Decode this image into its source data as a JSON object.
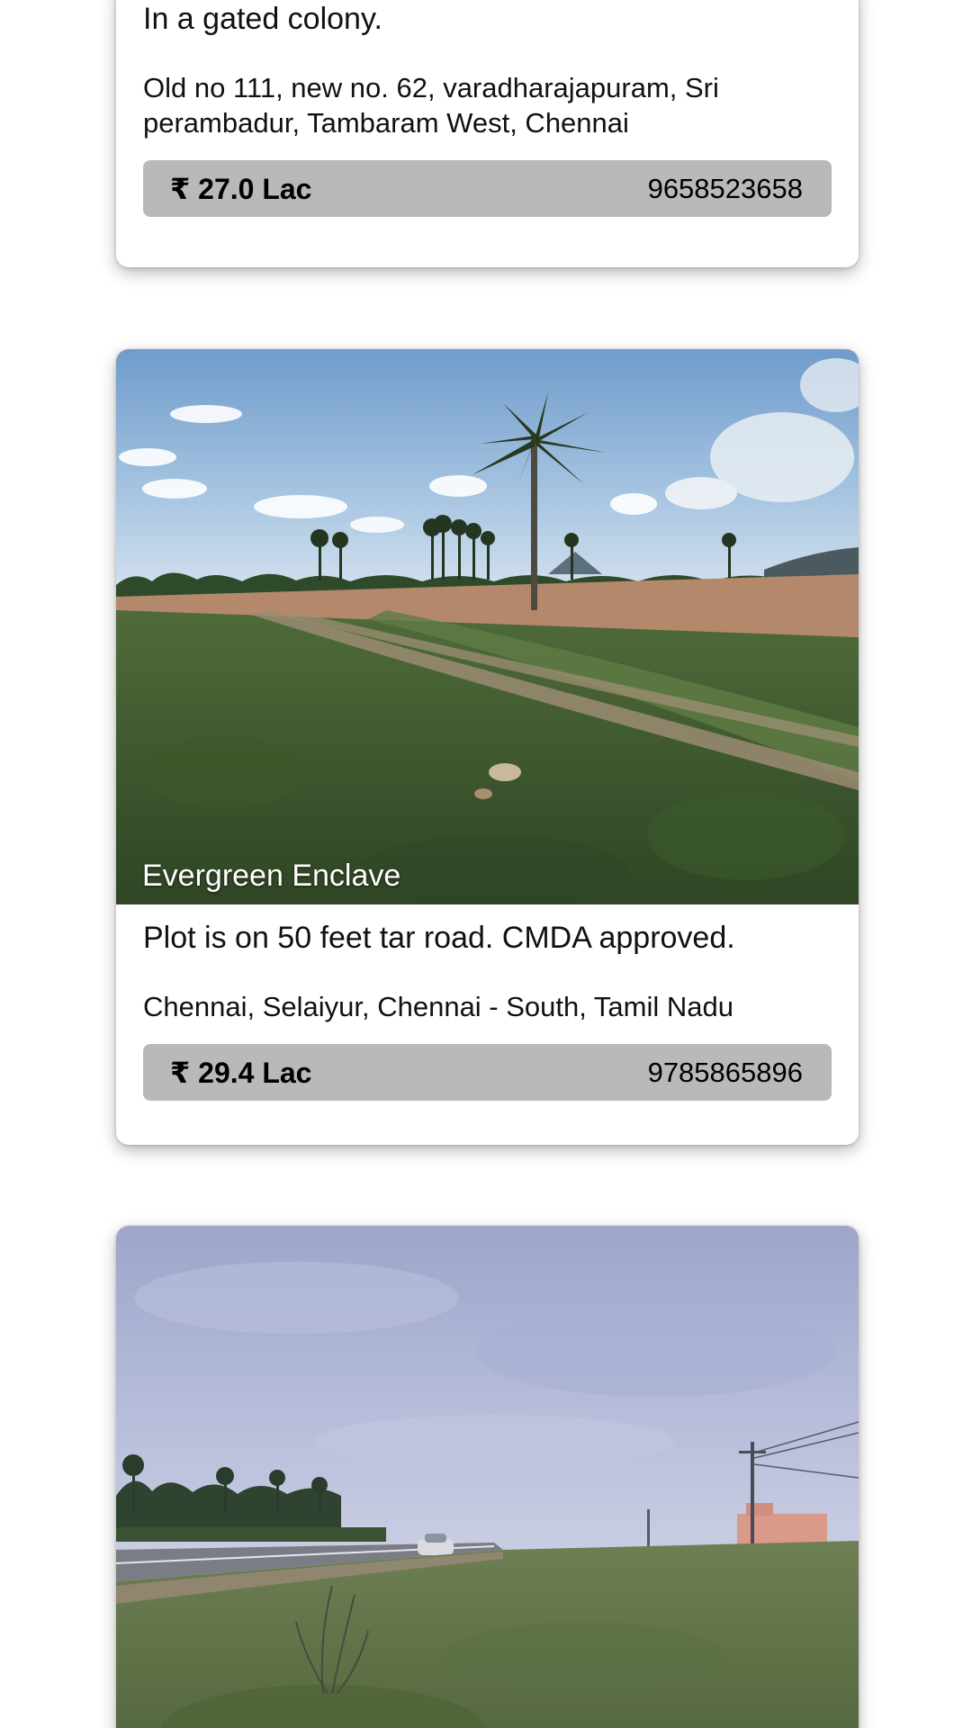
{
  "listings": [
    {
      "tagline": "In a gated colony.",
      "address": "Old no 111, new no. 62, varadharajapuram, Sri perambadur, Tambaram West, Chennai",
      "price": "₹ 27.0 Lac",
      "phone": "9658523658"
    },
    {
      "title": "Evergreen Enclave",
      "tagline": "Plot is on 50 feet tar road. CMDA approved.",
      "address": "Chennai, Selaiyur, Chennai - South, Tamil Nadu",
      "price": "₹ 29.4 Lac",
      "phone": "9785865896"
    },
    {
      "title": ""
    }
  ],
  "colors": {
    "price_bar": "#b9b9b9",
    "card_bg": "#ffffff"
  }
}
